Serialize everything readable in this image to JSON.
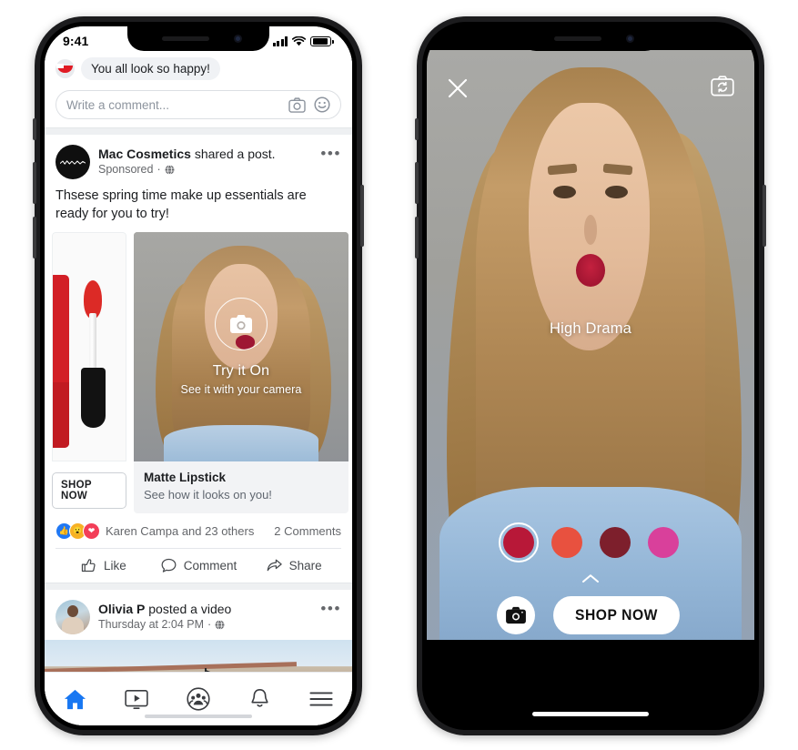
{
  "left_phone": {
    "status_bar": {
      "time": "9:41",
      "signal_icon": "signal-bars-icon",
      "wifi_icon": "wifi-icon",
      "battery_icon": "battery-icon"
    },
    "top_comment": {
      "text": "You all look so happy!",
      "avatar_icon": "lips-avatar-icon"
    },
    "comment_input": {
      "placeholder": "Write a comment...",
      "camera_icon": "camera-icon",
      "emoji_icon": "smiley-icon"
    },
    "sponsored_post": {
      "avatar_icon": "mac-cosmetics-logo-icon",
      "headline_name": "Mac Cosmetics",
      "headline_rest": " shared a post.",
      "meta": "Sponsored",
      "privacy_icon": "globe-icon",
      "menu_icon": "more-options-icon",
      "body": "Thsese spring time make up essentials are ready for you to try!",
      "cards": [
        {
          "title": "",
          "subtitle": "",
          "cta": "SHOP NOW",
          "image": "lipstick-product-image"
        },
        {
          "title": "Matte Lipstick",
          "subtitle": "See how it looks on you!",
          "image": "model-photo",
          "overlay": {
            "title": "Try it On",
            "subtitle": "See it with your camera",
            "icon": "camera-icon"
          }
        }
      ],
      "reactions": {
        "icons": [
          "like-reaction-icon",
          "wow-reaction-icon",
          "love-reaction-icon"
        ],
        "text": "Karen Campa and 23 others",
        "comments": "2 Comments"
      },
      "actions": [
        {
          "label": "Like",
          "icon": "thumbs-up-icon"
        },
        {
          "label": "Comment",
          "icon": "comment-bubble-icon"
        },
        {
          "label": "Share",
          "icon": "share-arrow-icon"
        }
      ]
    },
    "second_post": {
      "avatar_icon": "user-avatar-icon",
      "headline_name": "Olivia P",
      "headline_rest": " posted a video",
      "meta": "Thursday at 2:04 PM",
      "privacy_icon": "globe-icon",
      "menu_icon": "more-options-icon"
    },
    "tab_bar": [
      {
        "name": "home",
        "icon": "home-icon",
        "active": true
      },
      {
        "name": "watch",
        "icon": "video-icon",
        "active": false
      },
      {
        "name": "groups",
        "icon": "groups-icon",
        "active": false
      },
      {
        "name": "notifications",
        "icon": "bell-icon",
        "active": false
      },
      {
        "name": "menu",
        "icon": "hamburger-menu-icon",
        "active": false
      }
    ]
  },
  "right_phone": {
    "close_icon": "close-x-icon",
    "flip_camera_icon": "flip-camera-icon",
    "shade_label": "High Drama",
    "swatches": [
      {
        "color": "#b81838",
        "selected": true
      },
      {
        "color": "#e8513f",
        "selected": false
      },
      {
        "color": "#7d1f2c",
        "selected": false
      },
      {
        "color": "#d9409b",
        "selected": false
      }
    ],
    "expand_icon": "chevron-up-icon",
    "shutter_icon": "camera-icon",
    "shop_button": "SHOP NOW"
  },
  "colors": {
    "brand_blue": "#1877f2",
    "like_blue": "#2078f4",
    "wow_yellow": "#f7b125",
    "love_red": "#f33e58"
  }
}
